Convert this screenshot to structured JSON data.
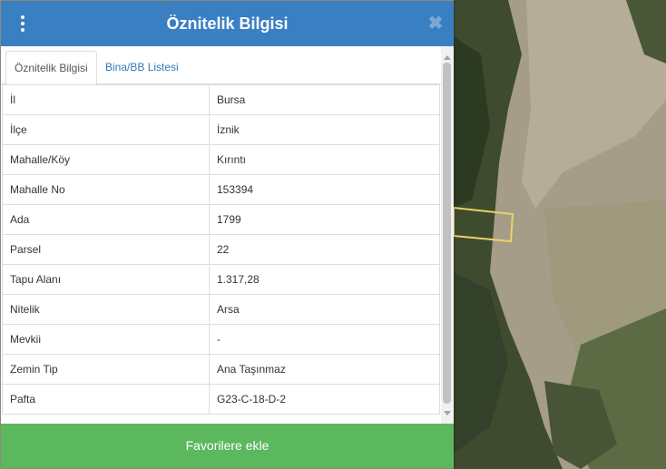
{
  "header": {
    "title": "Öznitelik Bilgisi",
    "close_glyph": "✖",
    "menu_icon": "vertical-dots-icon",
    "color": "#3a7fc1"
  },
  "tabs": [
    {
      "label": "Öznitelik Bilgisi",
      "active": true
    },
    {
      "label": "Bina/BB Listesi",
      "active": false
    }
  ],
  "attributes": [
    {
      "key": "İl",
      "value": "Bursa"
    },
    {
      "key": "İlçe",
      "value": "İznik"
    },
    {
      "key": "Mahalle/Köy",
      "value": "Kırıntı"
    },
    {
      "key": "Mahalle No",
      "value": "153394"
    },
    {
      "key": "Ada",
      "value": "1799"
    },
    {
      "key": "Parsel",
      "value": "22"
    },
    {
      "key": "Tapu Alanı",
      "value": "1.317,28"
    },
    {
      "key": "Nitelik",
      "value": "Arsa"
    },
    {
      "key": "Mevkii",
      "value": "-"
    },
    {
      "key": "Zemin Tip",
      "value": "Ana Taşınmaz"
    },
    {
      "key": "Pafta",
      "value": "G23-C-18-D-2"
    }
  ],
  "footer": {
    "button_label": "Favorilere ekle",
    "color": "#5cb85c"
  },
  "map": {
    "parcel_outline_color": "#e8d36a"
  }
}
